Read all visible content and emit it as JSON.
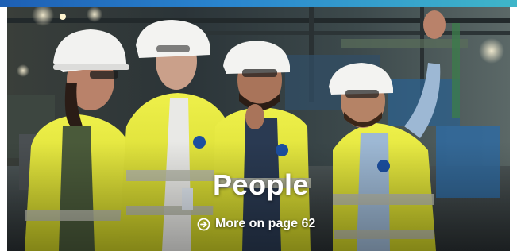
{
  "banner": {
    "title": "People",
    "link_label": "More on page 62",
    "link_icon": "circle-arrow-right-icon"
  },
  "colors": {
    "top_bar_start": "#1d5fb4",
    "top_bar_end": "#3fb6c9",
    "vest_yellow": "#e3e42f",
    "text": "#ffffff"
  }
}
